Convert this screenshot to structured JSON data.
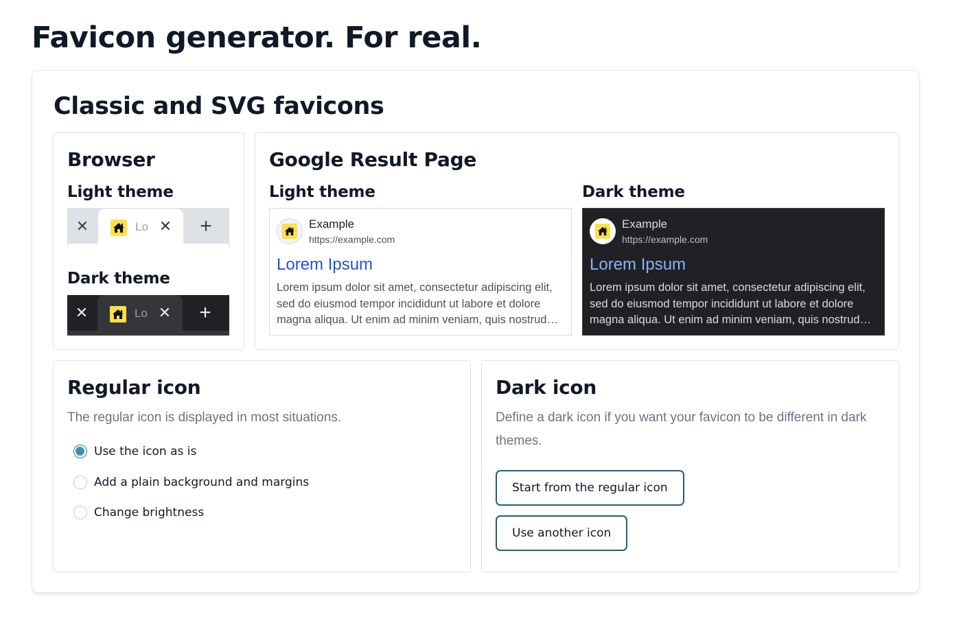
{
  "page": {
    "title": "Favicon generator. For real."
  },
  "section": {
    "title": "Classic and SVG favicons"
  },
  "browser": {
    "title": "Browser",
    "light_label": "Light theme",
    "dark_label": "Dark theme",
    "tab_text": "Lorem Ipsum",
    "close_glyph": "✕",
    "plus_glyph": "+"
  },
  "serp": {
    "title": "Google Result Page",
    "light_label": "Light theme",
    "dark_label": "Dark theme",
    "site_name": "Example",
    "site_url": "https://example.com",
    "result_title": "Lorem Ipsum",
    "snippet": "Lorem ipsum dolor sit amet, consectetur adipiscing elit, sed do eiusmod tempor incididunt ut labore et dolore magna aliqua. Ut enim ad minim veniam, quis nostrud exercitation ullamco laboris nisi ut aliquip ex ea commodo consequat."
  },
  "regular_icon": {
    "title": "Regular icon",
    "description": "The regular icon is displayed in most situations.",
    "options": [
      {
        "label": "Use the icon as is",
        "checked": true
      },
      {
        "label": "Add a plain background and margins",
        "checked": false
      },
      {
        "label": "Change brightness",
        "checked": false
      }
    ]
  },
  "dark_icon": {
    "title": "Dark icon",
    "description": "Define a dark icon if you want your favicon to be different in dark themes.",
    "start_button": "Start from the regular icon",
    "other_button": "Use another icon"
  },
  "colors": {
    "favicon_yellow": "#fde047",
    "accent": "#1f5f78",
    "radio_checked": "#3d89a3",
    "serp_light_link": "#1f55d6",
    "serp_dark_link": "#8ab4f8",
    "dark_bg": "#202124"
  },
  "icons": {
    "favicon": "house-icon",
    "close": "close-icon",
    "new_tab": "plus-icon"
  }
}
